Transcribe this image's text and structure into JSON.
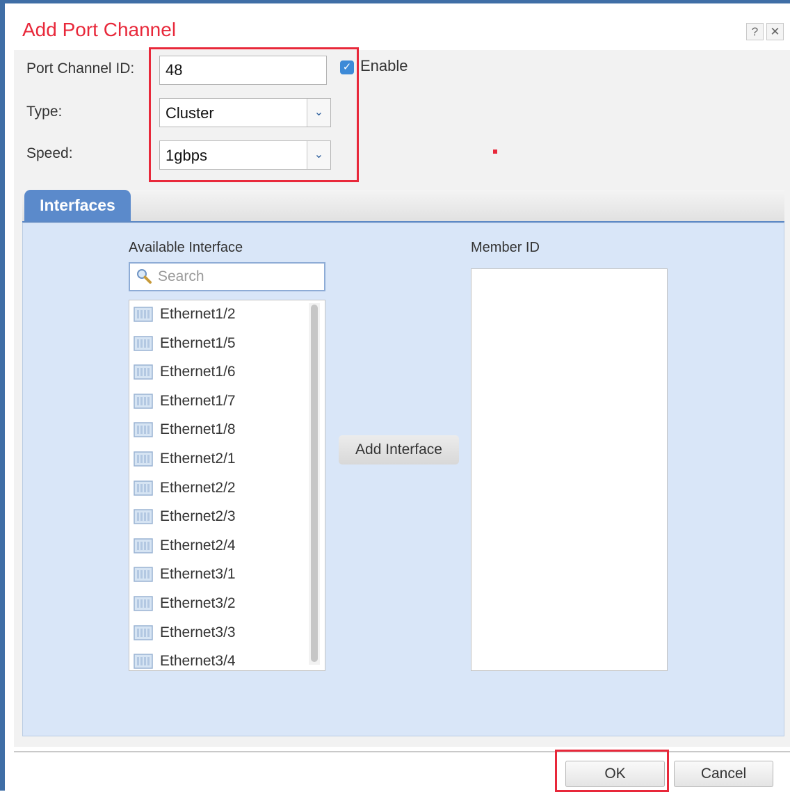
{
  "dialog": {
    "title": "Add Port Channel",
    "help_label": "?",
    "close_label": "✕"
  },
  "form": {
    "port_channel_id_label": "Port Channel ID:",
    "port_channel_id_value": "48",
    "enable_label": "Enable",
    "enable_checked": true,
    "type_label": "Type:",
    "type_value": "Cluster",
    "speed_label": "Speed:",
    "speed_value": "1gbps"
  },
  "tabs": [
    {
      "label": "Interfaces",
      "active": true
    }
  ],
  "interfaces": {
    "available_label": "Available Interface",
    "search_placeholder": "Search",
    "member_label": "Member ID",
    "add_button_label": "Add Interface",
    "available_items": [
      "Ethernet1/2",
      "Ethernet1/5",
      "Ethernet1/6",
      "Ethernet1/7",
      "Ethernet1/8",
      "Ethernet2/1",
      "Ethernet2/2",
      "Ethernet2/3",
      "Ethernet2/4",
      "Ethernet3/1",
      "Ethernet3/2",
      "Ethernet3/3",
      "Ethernet3/4"
    ],
    "member_items": []
  },
  "footer": {
    "ok_label": "OK",
    "cancel_label": "Cancel"
  },
  "colors": {
    "title": "#e8283a",
    "highlight_box": "#e8283a",
    "tab_active": "#5b8acb",
    "panel_background": "#d9e6f8",
    "checkbox": "#3d8ad7"
  }
}
